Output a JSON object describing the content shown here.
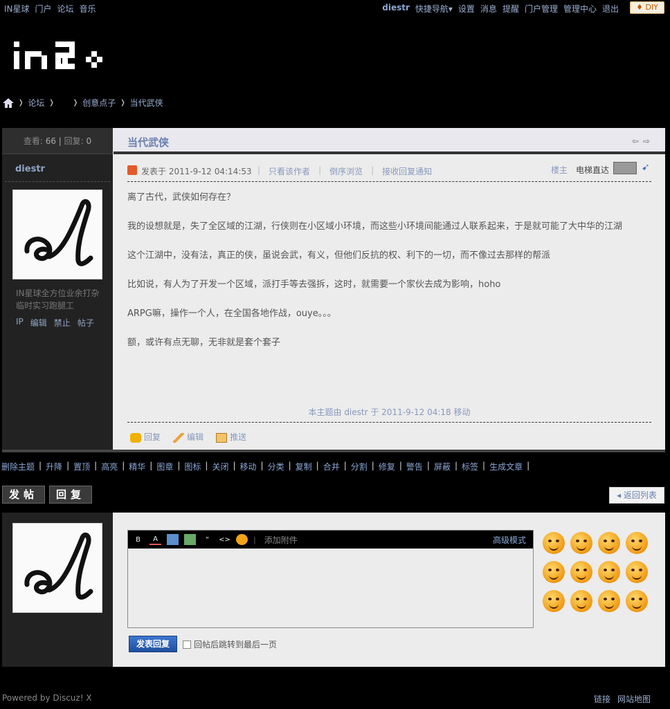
{
  "topbar": {
    "left_links": [
      "IN星球",
      "门户",
      "论坛",
      "音乐"
    ],
    "username": "diestr",
    "right_links": [
      "快捷导航▾",
      "设置",
      "消息",
      "提醒",
      "门户管理",
      "管理中心",
      "退出"
    ],
    "diy_label": "DIY"
  },
  "logo": {
    "text": "in2"
  },
  "breadcrumb": {
    "items": [
      "论坛",
      "",
      "创意点子",
      "当代武侠"
    ]
  },
  "thread": {
    "views_label": "查看:",
    "views": "66",
    "replies_label": "回复:",
    "replies": "0",
    "title": "当代武侠",
    "author": "diestr",
    "author_desc": "IN星球全方位业余打杂临时实习跑腿工",
    "author_actions": [
      "IP",
      "编辑",
      "禁止",
      "帖子"
    ],
    "posted_at": "发表于 2011-9-12 04:14:53",
    "post_links": [
      "只看该作者",
      "倒序浏览",
      "接收回复通知"
    ],
    "floor_label": "楼主",
    "elevator_label": "电梯直达",
    "body": [
      "离了古代，武侠如何存在？",
      "我的设想就是，失了全区域的江湖，行侠则在小区域小环境，而这些小环境间能通过人联系起来，于是就可能了大中华的江湖",
      "这个江湖中，没有法，真正的侠，虽说会武，有义，但他们反抗的权、利下的一切，而不像过去那样的帮派",
      "比如说，有人为了开发一个区域，派打手等去强拆，这时，就需要一个家伙去成为影响，hoho",
      "ARPG嘛，操作一个人，在全国各地作战，ouye。。。",
      "额，或许有点无聊，无非就是套个套子"
    ],
    "moved_note": "本主题由 diestr 于 2011-9-12 04:18 移动",
    "actions": [
      "回复",
      "编辑",
      "推送"
    ]
  },
  "modbar": [
    "删除主题",
    "升降",
    "置顶",
    "高亮",
    "精华",
    "图章",
    "图标",
    "关闭",
    "移动",
    "分类",
    "复制",
    "合并",
    "分割",
    "修复",
    "警告",
    "屏蔽",
    "标签",
    "生成文章"
  ],
  "buttons": {
    "new_topic": "发帖",
    "reply": "回复",
    "back_list": "返回列表"
  },
  "reply_box": {
    "toolbar_icons": [
      "bold-icon",
      "font-color-icon",
      "image-icon",
      "link-icon",
      "quote-icon",
      "code-icon",
      "smiley-icon"
    ],
    "attach_label": "添加附件",
    "advanced_label": "高级模式",
    "submit_label": "发表回复",
    "jump_label": "回帖后跳转到最后一页"
  },
  "footer": {
    "powered": "Powered by Discuz! X",
    "links": [
      "链接",
      "网站地图"
    ]
  },
  "colors": {
    "background": "#000000",
    "link": "#8aa7d6",
    "panel": "#ececec",
    "submit": "#1f4f9e"
  }
}
